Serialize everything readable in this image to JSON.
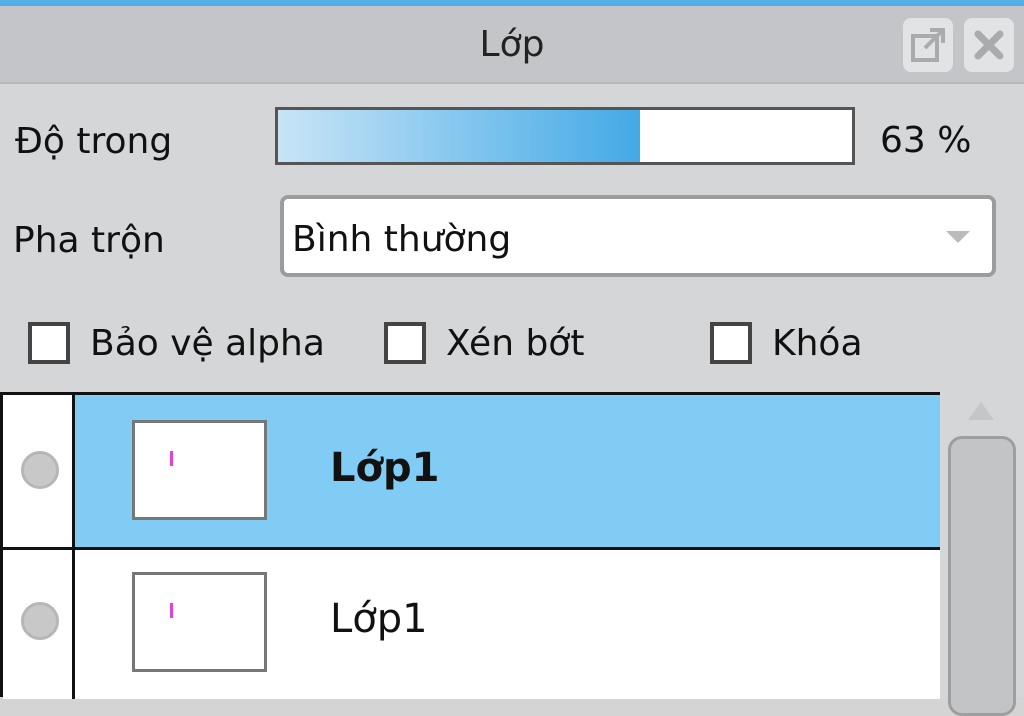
{
  "panel": {
    "title": "Lớp",
    "float_icon": "popout-icon",
    "close_icon": "close-icon"
  },
  "opacity": {
    "label": "Độ trong",
    "value": 63,
    "value_text": "63 %"
  },
  "blend": {
    "label": "Pha trộn",
    "value": "Bình thường"
  },
  "checkboxes": [
    {
      "label": "Bảo vệ alpha",
      "checked": false
    },
    {
      "label": "Xén bớt",
      "checked": false
    },
    {
      "label": "Khóa",
      "checked": false
    }
  ],
  "layers": [
    {
      "name": "Lớp1",
      "selected": true
    },
    {
      "name": "Lớp1",
      "selected": false
    }
  ],
  "colors": {
    "accent": "#55aee6",
    "selected_row": "#80ccf4"
  }
}
